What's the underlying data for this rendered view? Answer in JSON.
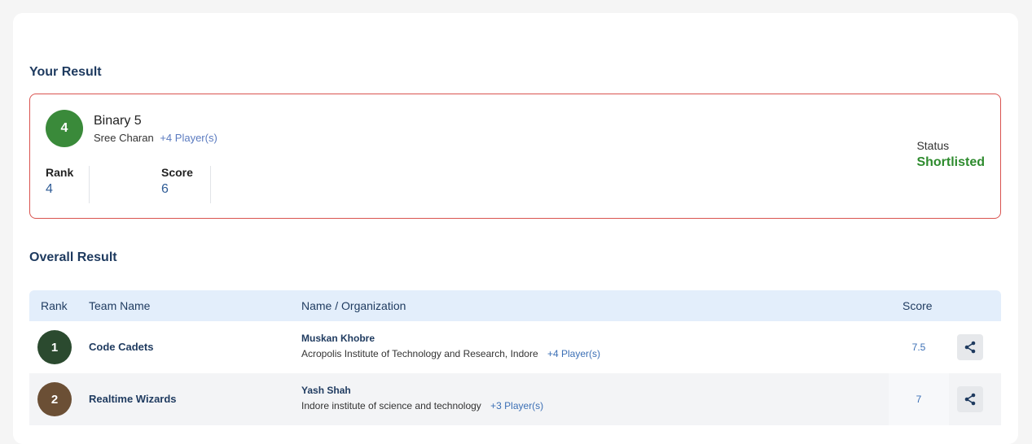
{
  "your_result": {
    "section_title": "Your Result",
    "rank_badge": "4",
    "team_name": "Binary 5",
    "leader": "Sree Charan",
    "players_more": "+4 Player(s)",
    "rank_label": "Rank",
    "rank_value": "4",
    "score_label": "Score",
    "score_value": "6",
    "status_label": "Status",
    "status_value": "Shortlisted"
  },
  "overall_result": {
    "section_title": "Overall Result",
    "columns": {
      "rank": "Rank",
      "team": "Team Name",
      "org": "Name / Organization",
      "score": "Score"
    },
    "rows": [
      {
        "rank": "1",
        "team": "Code Cadets",
        "person": "Muskan Khobre",
        "organization": "Acropolis Institute of Technology and Research, Indore",
        "players_more": "+4 Player(s)",
        "score": "7.5",
        "badge_color": "#2b4a2f"
      },
      {
        "rank": "2",
        "team": "Realtime Wizards",
        "person": "Yash Shah",
        "organization": "Indore institute of science and technology",
        "players_more": "+3 Player(s)",
        "score": "7",
        "badge_color": "#6b4f35"
      }
    ]
  },
  "colors": {
    "status_shortlisted": "#2e8b2e",
    "result_border": "#d9534f",
    "your_rank_badge": "#3a8a3a",
    "table_header_bg": "#e3eefb"
  },
  "icons": {
    "share": "share-icon"
  }
}
